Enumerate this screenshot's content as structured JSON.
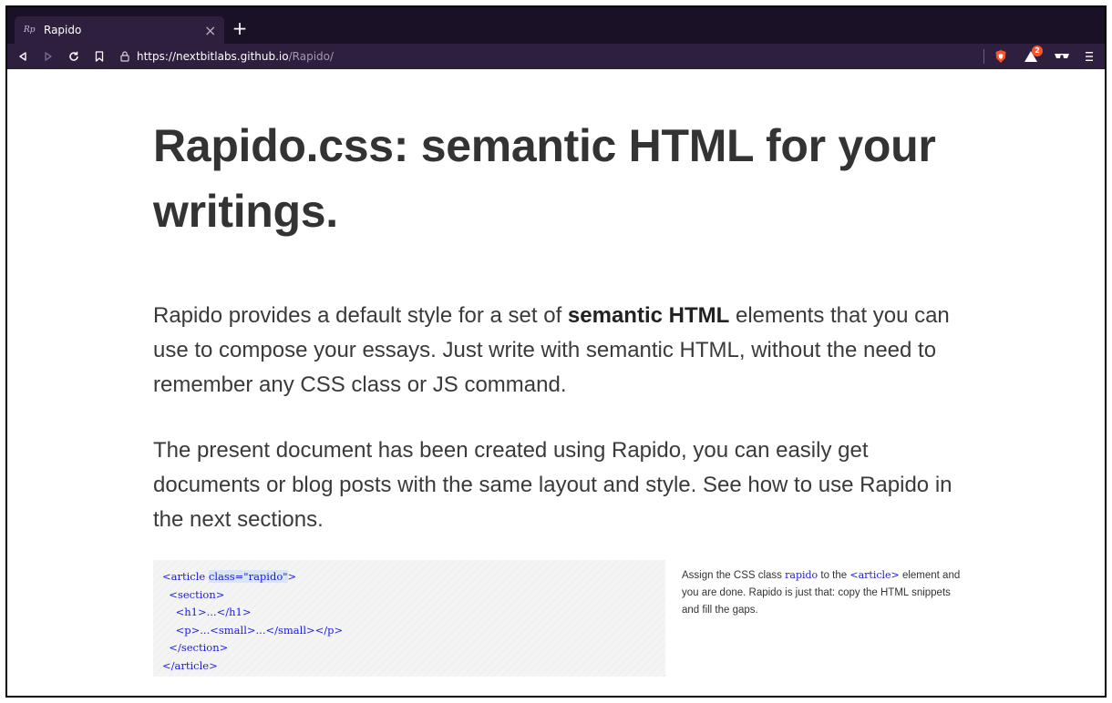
{
  "browser": {
    "tab_title": "Rapido",
    "tab_favicon_text": "Rp",
    "tab_close": "×",
    "new_tab": "+",
    "url_host": "https://nextbitlabs.github.io",
    "url_path": "/Rapido/",
    "rewards_badge": "2",
    "accent_color": "#fb542b",
    "icons": [
      "back-icon",
      "forward-icon",
      "reload-icon",
      "bookmark-icon",
      "lock-icon",
      "brave-shield-icon",
      "brave-rewards-icon",
      "private-glasses-icon",
      "menu-icon"
    ]
  },
  "page": {
    "title": "Rapido.css: semantic HTML for your writings.",
    "para1_before": "Rapido provides a default style for a set of ",
    "para1_strong": "semantic HTML",
    "para1_after": " elements that you can use to compose your essays. Just write with semantic HTML, without the need to remember any CSS class or JS command.",
    "para2": "The present document has been created using Rapido, you can easily get documents or blog posts with the same layout and style. See how to use Rapido in the next sections.",
    "code": {
      "line1_before": "<article ",
      "line1_hl": "class=\"rapido\"",
      "line1_after": ">",
      "line2": "  <section>",
      "line3": "    <h1>...</h1>",
      "line4": "    <p>...<small>...</small></p>",
      "line5": "  </section>",
      "line6": "</article>"
    },
    "aside": {
      "t1": "Assign the CSS class ",
      "c1": "rapido",
      "t2": " to the ",
      "c2": "<article>",
      "t3": " element and you are done. Rapido is just that: copy the HTML snippets and fill the gaps."
    }
  }
}
